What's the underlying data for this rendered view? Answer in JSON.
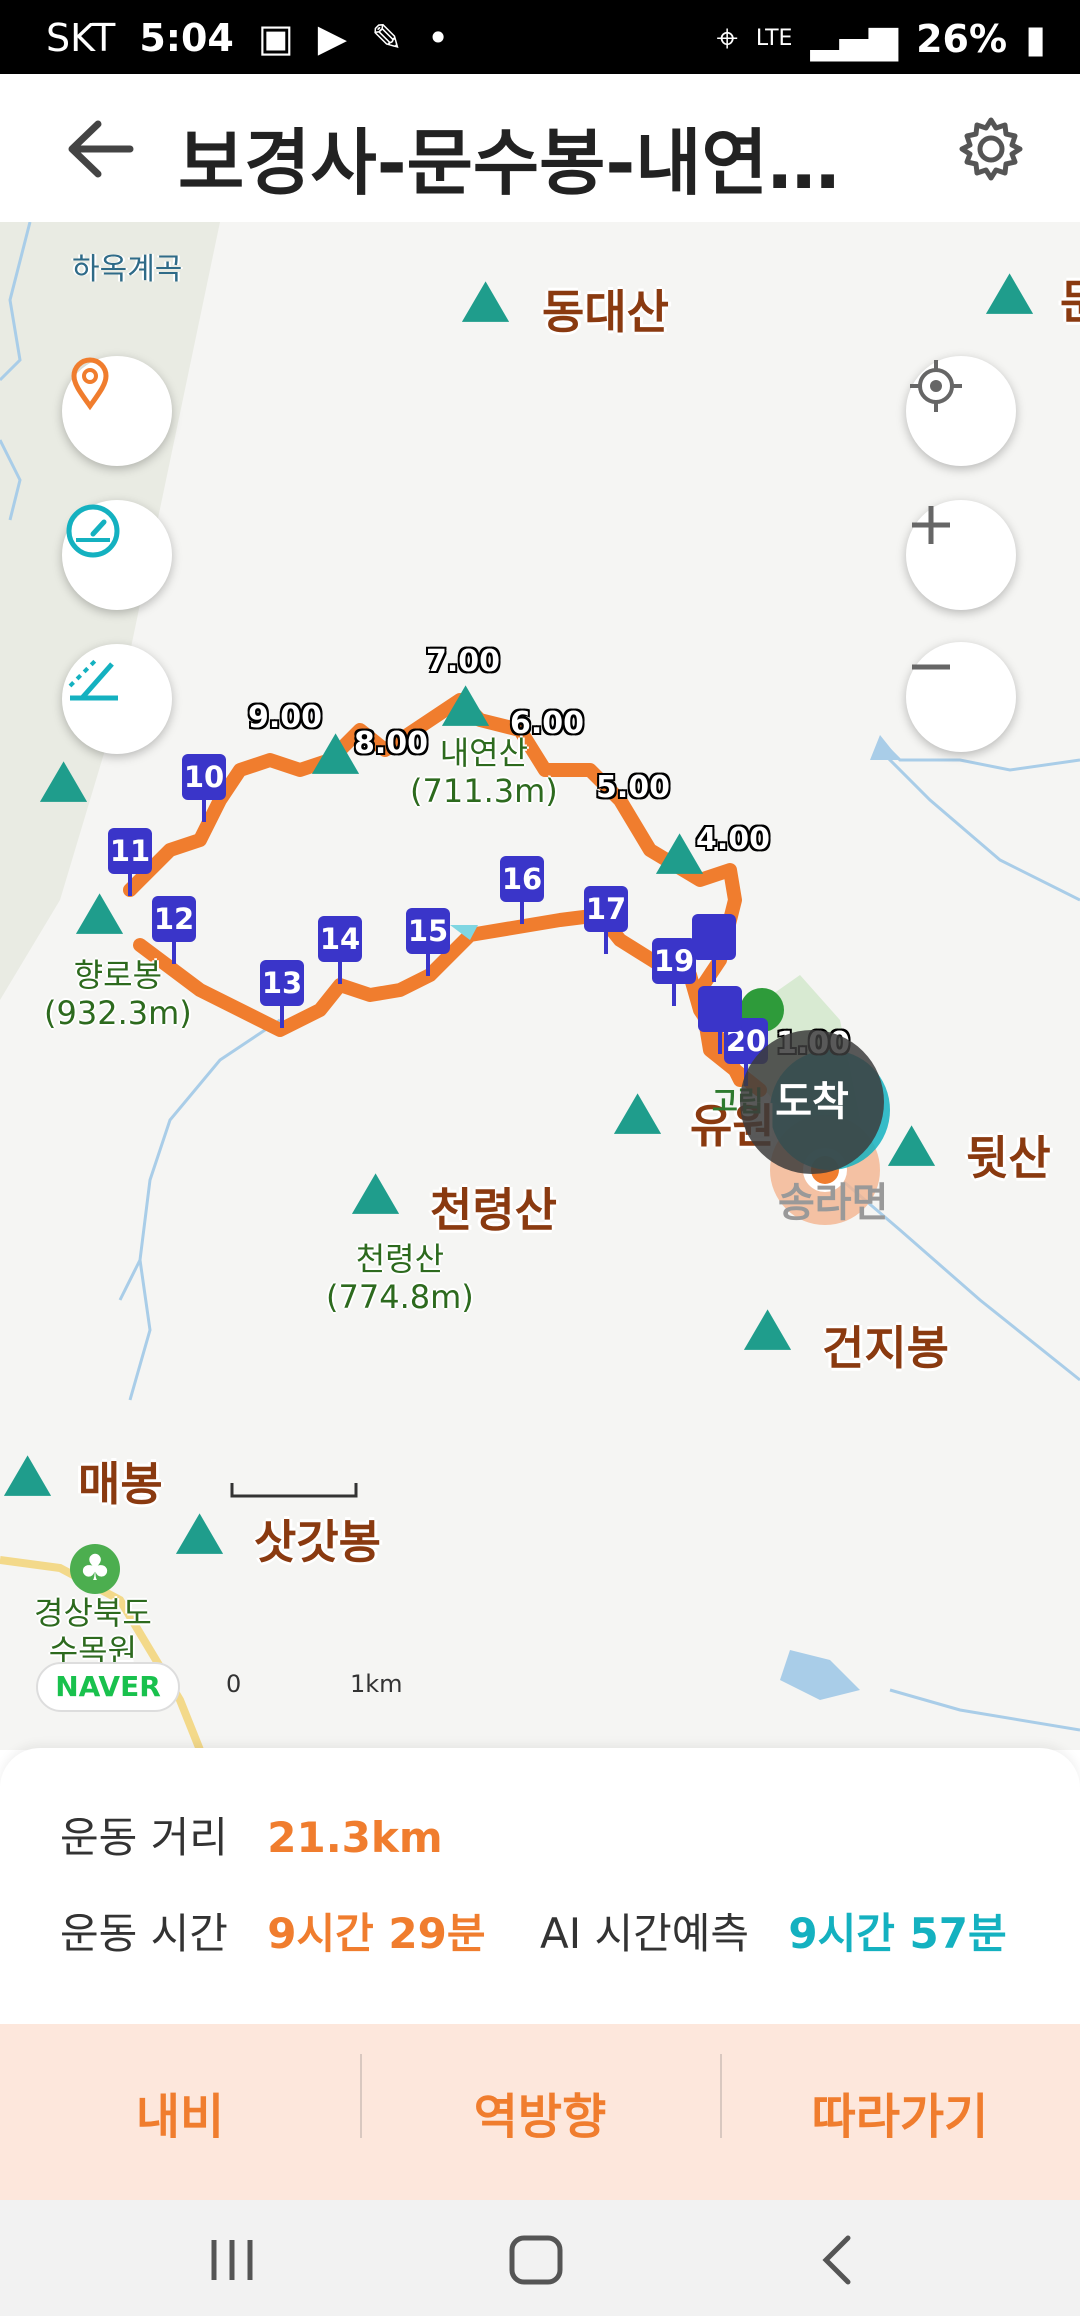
{
  "status_bar": {
    "carrier": "SKT",
    "time": "5:04",
    "network": "LTE",
    "battery": "26%"
  },
  "header": {
    "title": "보경사-문수봉-내연…",
    "back_icon": "back-arrow-icon",
    "settings_icon": "gear-icon"
  },
  "map": {
    "places": {
      "hamok": "하옥계곡",
      "dongdae": "동대산",
      "mun_partial": "문",
      "naeyeon_name": "내연산",
      "naeyeon_elev": "(711.3m)",
      "hyangro_name": "향로봉",
      "hyangro_elev": "(932.3m)",
      "yuwon": "유원",
      "dwit": "뒷산",
      "songra": "송라면",
      "cheonryeong": "천령산",
      "cheonryeong_name": "천령산",
      "cheonryeong_elev": "(774.8m)",
      "geonji": "건지봉",
      "mae": "매봉",
      "satgat": "삿갓봉",
      "arboretum_1": "경상북도",
      "arboretum_2": "수목원",
      "goril": "고립"
    },
    "markers": [
      "10",
      "11",
      "12",
      "13",
      "14",
      "15",
      "16",
      "17",
      "19",
      "20"
    ],
    "km_labels": [
      "9.00",
      "8.00",
      "7.00",
      "6.00",
      "5.00",
      "4.00",
      "1.00"
    ],
    "arrive_label": "도착",
    "naver_logo": "NAVER",
    "scale": {
      "start": "0",
      "end": "1km"
    },
    "route_color": "#f07d2e",
    "marker_color": "#3a35c9"
  },
  "stats": {
    "distance_label": "운동 거리",
    "distance_value": "21.3km",
    "time_label": "운동 시간",
    "time_value": "9시간 29분",
    "ai_label": "AI 시간예측",
    "ai_value": "9시간 57분"
  },
  "tabs": [
    {
      "label": "내비"
    },
    {
      "label": "역방향"
    },
    {
      "label": "따라가기"
    }
  ],
  "colors": {
    "accent": "#f07d2e",
    "teal": "#14b1c0",
    "tab_bg": "#fde7dc"
  }
}
